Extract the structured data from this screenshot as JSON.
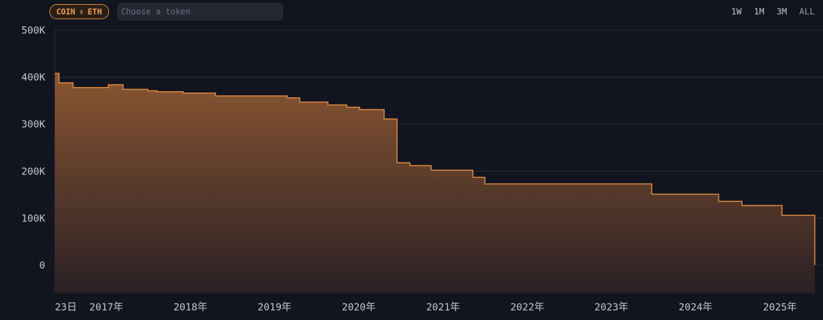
{
  "toolbar": {
    "pair_left": "COIN",
    "pair_right": "ETH",
    "swap_icon": "⇕",
    "token_placeholder": "Choose a token"
  },
  "ranges": [
    "1W",
    "1M",
    "3M",
    "ALL"
  ],
  "colors": {
    "background": "#121520",
    "line": "#e08a3c",
    "fill_top": "#8a5632",
    "fill_bottom": "#2a2024",
    "grid": "#2a2d38",
    "tick_text": "#c4c7d0"
  },
  "chart_data": {
    "type": "area",
    "step": true,
    "ylim": [
      0,
      500000
    ],
    "yticks": [
      0,
      100000,
      200000,
      300000,
      400000,
      500000
    ],
    "ytick_labels": [
      "0",
      "100K",
      "200K",
      "300K",
      "400K",
      "500K"
    ],
    "xlim": [
      "2016-05-23",
      "2025-06-01"
    ],
    "xticks": [
      {
        "label": "23日",
        "date": "2016-05-23"
      },
      {
        "label": "2017年",
        "date": "2017-01-01"
      },
      {
        "label": "2018年",
        "date": "2018-01-01"
      },
      {
        "label": "2019年",
        "date": "2019-01-01"
      },
      {
        "label": "2020年",
        "date": "2020-01-01"
      },
      {
        "label": "2021年",
        "date": "2021-01-01"
      },
      {
        "label": "2022年",
        "date": "2022-01-01"
      },
      {
        "label": "2023年",
        "date": "2023-01-01"
      },
      {
        "label": "2024年",
        "date": "2024-01-01"
      },
      {
        "label": "2025年",
        "date": "2025-01-01"
      }
    ],
    "grid": true,
    "points": [
      {
        "date": "2016-05-23",
        "value": 408000
      },
      {
        "date": "2016-06-10",
        "value": 388000
      },
      {
        "date": "2016-08-10",
        "value": 378000
      },
      {
        "date": "2017-01-10",
        "value": 384000
      },
      {
        "date": "2017-03-15",
        "value": 374000
      },
      {
        "date": "2017-07-01",
        "value": 371000
      },
      {
        "date": "2017-08-10",
        "value": 369000
      },
      {
        "date": "2017-12-01",
        "value": 366000
      },
      {
        "date": "2018-04-20",
        "value": 360000
      },
      {
        "date": "2019-02-25",
        "value": 356000
      },
      {
        "date": "2019-04-20",
        "value": 347000
      },
      {
        "date": "2019-08-20",
        "value": 341000
      },
      {
        "date": "2019-11-10",
        "value": 336000
      },
      {
        "date": "2020-01-05",
        "value": 331000
      },
      {
        "date": "2020-04-20",
        "value": 311000
      },
      {
        "date": "2020-06-15",
        "value": 218000
      },
      {
        "date": "2020-08-10",
        "value": 212000
      },
      {
        "date": "2020-11-10",
        "value": 202000
      },
      {
        "date": "2021-05-10",
        "value": 187000
      },
      {
        "date": "2021-07-01",
        "value": 173000
      },
      {
        "date": "2023-06-25",
        "value": 151000
      },
      {
        "date": "2024-04-10",
        "value": 136000
      },
      {
        "date": "2024-07-20",
        "value": 127000
      },
      {
        "date": "2025-01-10",
        "value": 106000
      },
      {
        "date": "2025-06-01",
        "value": 0
      }
    ]
  }
}
